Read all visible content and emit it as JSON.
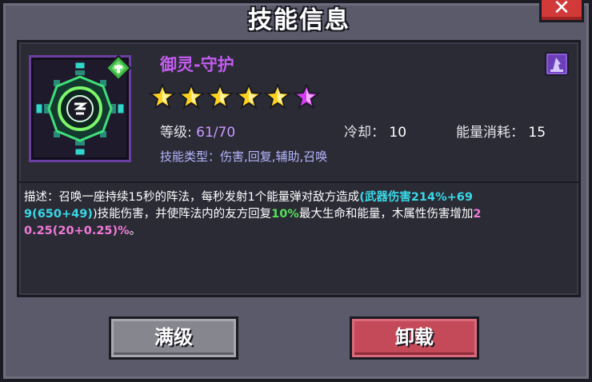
{
  "dialog": {
    "title": "技能信息",
    "close_label": "✕"
  },
  "skill": {
    "name": "御灵-守护",
    "stars_total": 6,
    "stars_gold": 5,
    "stars_purple": 1,
    "level_label": "等级:",
    "level_value": "61/70",
    "cooldown_label": "冷却：",
    "cooldown_value": "10",
    "energy_label": "能量消耗：",
    "energy_value": "15",
    "type_line": "技能类型：伤害,回复,辅助,召唤",
    "icon": "summon-array-icon",
    "badge_icon": "leaf-element-icon",
    "type_tag_icon": "wizard-hat-icon"
  },
  "description": {
    "p1": "描述：召唤一座持续15秒的阵法，每秒发射1个能量弹对敌方造成",
    "p2": "(",
    "p3": "武器伤害214%+69",
    "p4": "9(650+49)",
    "p5": ")技能伤害，并使阵法内的友方回复",
    "p6": "10%",
    "p7": "最大生命和能量，木属性伤害增加",
    "p8": "2",
    "p9": "0.25(20+0.25)",
    "p10": "%",
    "p11": "。"
  },
  "buttons": {
    "max_level": "满级",
    "unload": "卸载"
  },
  "colors": {
    "accent_purple": "#c35cf0",
    "cyan": "#39d8e6",
    "green": "#56e05a",
    "pink": "#f07ad8"
  }
}
